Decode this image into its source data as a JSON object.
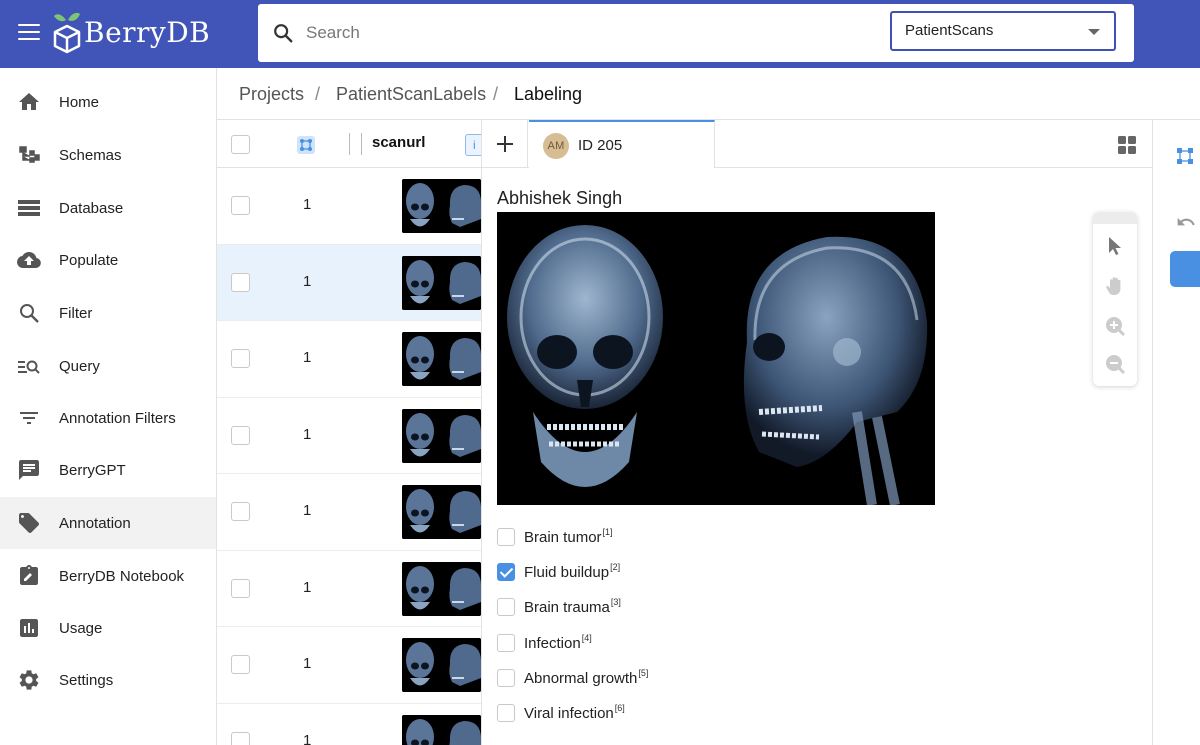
{
  "header": {
    "app_name": "BerryDB",
    "search_placeholder": "Search",
    "database_selected": "PatientScans"
  },
  "sidebar": {
    "items": [
      {
        "label": "Home",
        "icon": "home-icon"
      },
      {
        "label": "Schemas",
        "icon": "schema-icon"
      },
      {
        "label": "Database",
        "icon": "database-icon"
      },
      {
        "label": "Populate",
        "icon": "cloud-upload-icon"
      },
      {
        "label": "Filter",
        "icon": "search-icon"
      },
      {
        "label": "Query",
        "icon": "query-icon"
      },
      {
        "label": "Annotation Filters",
        "icon": "filter-icon"
      },
      {
        "label": "BerryGPT",
        "icon": "chat-icon"
      },
      {
        "label": "Annotation",
        "icon": "tag-icon"
      },
      {
        "label": "BerryDB Notebook",
        "icon": "notebook-icon"
      },
      {
        "label": "Usage",
        "icon": "chart-icon"
      },
      {
        "label": "Settings",
        "icon": "gear-icon"
      }
    ],
    "active": "Annotation"
  },
  "breadcrumb": {
    "items": [
      "Projects",
      "PatientScanLabels",
      "Labeling"
    ],
    "separator": "/"
  },
  "table": {
    "column_header": "scanurl",
    "filter_chip": "i",
    "rows": [
      {
        "count": "1",
        "selected": false
      },
      {
        "count": "1",
        "selected": true
      },
      {
        "count": "1",
        "selected": false
      },
      {
        "count": "1",
        "selected": false
      },
      {
        "count": "1",
        "selected": false
      },
      {
        "count": "1",
        "selected": false
      },
      {
        "count": "1",
        "selected": false
      },
      {
        "count": "1",
        "selected": false
      }
    ]
  },
  "labeling": {
    "tab": {
      "avatar_initials": "AM",
      "label": "ID 205"
    },
    "patient_name": "Abhishek Singh",
    "labels": [
      {
        "text": "Brain tumor",
        "hotkey": "[1]",
        "checked": false
      },
      {
        "text": "Fluid buildup",
        "hotkey": "[2]",
        "checked": true
      },
      {
        "text": "Brain trauma",
        "hotkey": "[3]",
        "checked": false
      },
      {
        "text": "Infection",
        "hotkey": "[4]",
        "checked": false
      },
      {
        "text": "Abnormal growth",
        "hotkey": "[5]",
        "checked": false
      },
      {
        "text": "Viral infection",
        "hotkey": "[6]",
        "checked": false
      }
    ]
  },
  "colors": {
    "header_bg": "#4154b7",
    "accent": "#4a90e2",
    "selected_row": "#e8f2fc",
    "active_nav": "#f2f2f2"
  }
}
